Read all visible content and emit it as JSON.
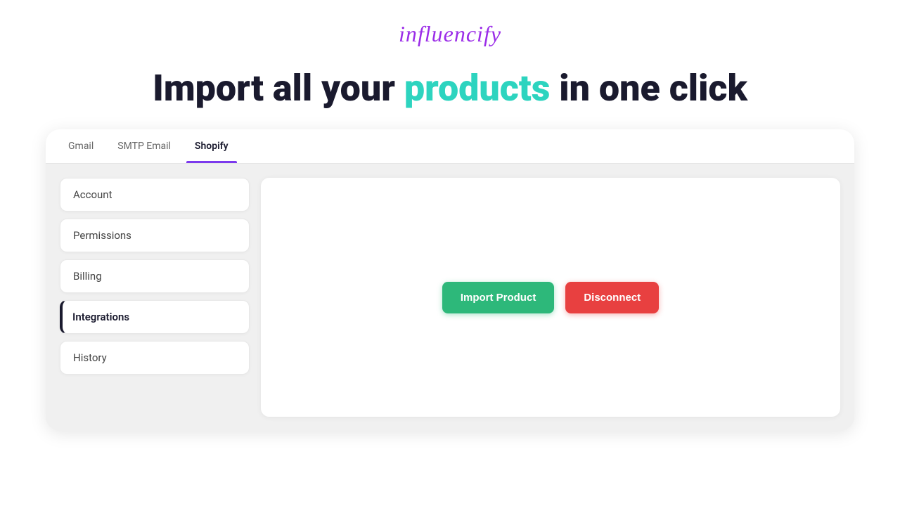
{
  "header": {
    "logo": "influencify",
    "hero_text_before": "Import all your ",
    "hero_highlight": "products",
    "hero_text_after": " in one click"
  },
  "tabs": [
    {
      "id": "gmail",
      "label": "Gmail",
      "active": false
    },
    {
      "id": "smtp",
      "label": "SMTP Email",
      "active": false
    },
    {
      "id": "shopify",
      "label": "Shopify",
      "active": true
    }
  ],
  "sidebar": {
    "items": [
      {
        "id": "account",
        "label": "Account",
        "active": false
      },
      {
        "id": "permissions",
        "label": "Permissions",
        "active": false
      },
      {
        "id": "billing",
        "label": "Billing",
        "active": false
      },
      {
        "id": "integrations",
        "label": "Integrations",
        "active": true
      },
      {
        "id": "history",
        "label": "History",
        "active": false
      }
    ]
  },
  "content": {
    "import_button_label": "Import Product",
    "disconnect_button_label": "Disconnect"
  },
  "colors": {
    "logo": "#9b2de8",
    "highlight": "#2dd4bf",
    "active_tab_underline": "#7c3aed",
    "import_btn": "#2db87a",
    "disconnect_btn": "#e84040"
  }
}
